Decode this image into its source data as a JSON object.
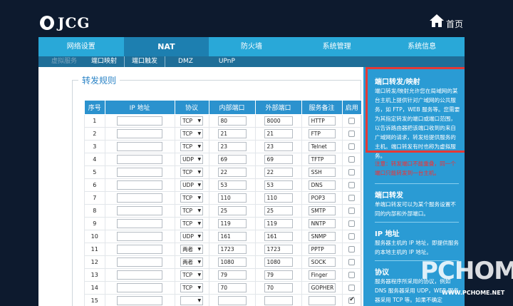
{
  "header": {
    "brand": "JCG",
    "home_label": "首页"
  },
  "nav": [
    "网络设置",
    "NAT",
    "防火墙",
    "系统管理",
    "系统信息"
  ],
  "subnav": [
    "虚拟服务",
    "端口映射",
    "端口触发",
    "DMZ",
    "UPnP"
  ],
  "rules": {
    "legend": "转发规则",
    "headers": [
      "序号",
      "IP 地址",
      "协议",
      "内部端口",
      "外部端口",
      "服务备注",
      "启用"
    ],
    "rows": [
      {
        "n": "1",
        "ip": "",
        "proto": "TCP",
        "in": "80",
        "out": "8000",
        "svc": "HTTP",
        "on": false
      },
      {
        "n": "2",
        "ip": "",
        "proto": "TCP",
        "in": "21",
        "out": "21",
        "svc": "FTP",
        "on": false
      },
      {
        "n": "3",
        "ip": "",
        "proto": "TCP",
        "in": "23",
        "out": "23",
        "svc": "Telnet",
        "on": false
      },
      {
        "n": "4",
        "ip": "",
        "proto": "UDP",
        "in": "69",
        "out": "69",
        "svc": "TFTP",
        "on": false
      },
      {
        "n": "5",
        "ip": "",
        "proto": "TCP",
        "in": "22",
        "out": "22",
        "svc": "SSH",
        "on": false
      },
      {
        "n": "6",
        "ip": "",
        "proto": "UDP",
        "in": "53",
        "out": "53",
        "svc": "DNS",
        "on": false
      },
      {
        "n": "7",
        "ip": "",
        "proto": "TCP",
        "in": "110",
        "out": "110",
        "svc": "POP3",
        "on": false
      },
      {
        "n": "8",
        "ip": "",
        "proto": "TCP",
        "in": "25",
        "out": "25",
        "svc": "SMTP",
        "on": false
      },
      {
        "n": "9",
        "ip": "",
        "proto": "TCP",
        "in": "119",
        "out": "119",
        "svc": "NNTP",
        "on": false
      },
      {
        "n": "10",
        "ip": "",
        "proto": "UDP",
        "in": "161",
        "out": "161",
        "svc": "SNMP",
        "on": false
      },
      {
        "n": "11",
        "ip": "",
        "proto": "两者",
        "in": "1723",
        "out": "1723",
        "svc": "PPTP",
        "on": false
      },
      {
        "n": "12",
        "ip": "",
        "proto": "两者",
        "in": "1080",
        "out": "1080",
        "svc": "SOCK",
        "on": false
      },
      {
        "n": "13",
        "ip": "",
        "proto": "TCP",
        "in": "79",
        "out": "79",
        "svc": "Finger",
        "on": false
      },
      {
        "n": "14",
        "ip": "",
        "proto": "TCP",
        "in": "70",
        "out": "70",
        "svc": "GOPHER",
        "on": false
      },
      {
        "n": "15",
        "ip": "",
        "proto": "",
        "in": "",
        "out": "",
        "svc": "",
        "on": true
      }
    ]
  },
  "help": {
    "title1": "端口转发/映射",
    "text1": "端口转发/映射允许您在局域网的某台主机上提供针对广域网的公共服务，如 FTP，WEB 服务等。您需要为其指定转发的端口或端口范围，以告诉路由器把该端口收到的来自广域网的请求，转发给提供服务的主机。端口转发有时也称为虚拟服务。",
    "warning": "注意：转发端口不能重叠，同一个端口只能转发到一台主机。",
    "title2": "端口转发",
    "text2": "单端口转发可以为某个服务设置不同的内部和外部端口。",
    "title3": "IP 地址",
    "text3": "服务器主机的 IP 地址，即提供服务的本地主机的 IP 地址。",
    "title4": "协议",
    "text4": "服务器程序所采用的协议，例如 DNS 服务器采用 UDP，WEB 服务器采用 TCP 等。如果不确定"
  },
  "watermark": {
    "big": "PCHOME",
    "small": "WWW.PCHOME.NET"
  },
  "colors": {
    "background": "#0d1a2e",
    "nav": "#29a8d8",
    "nav_active": "#1d7fb0",
    "table_header": "#2b92ce",
    "side": "#2a9bd4",
    "highlight": "#e53935"
  }
}
